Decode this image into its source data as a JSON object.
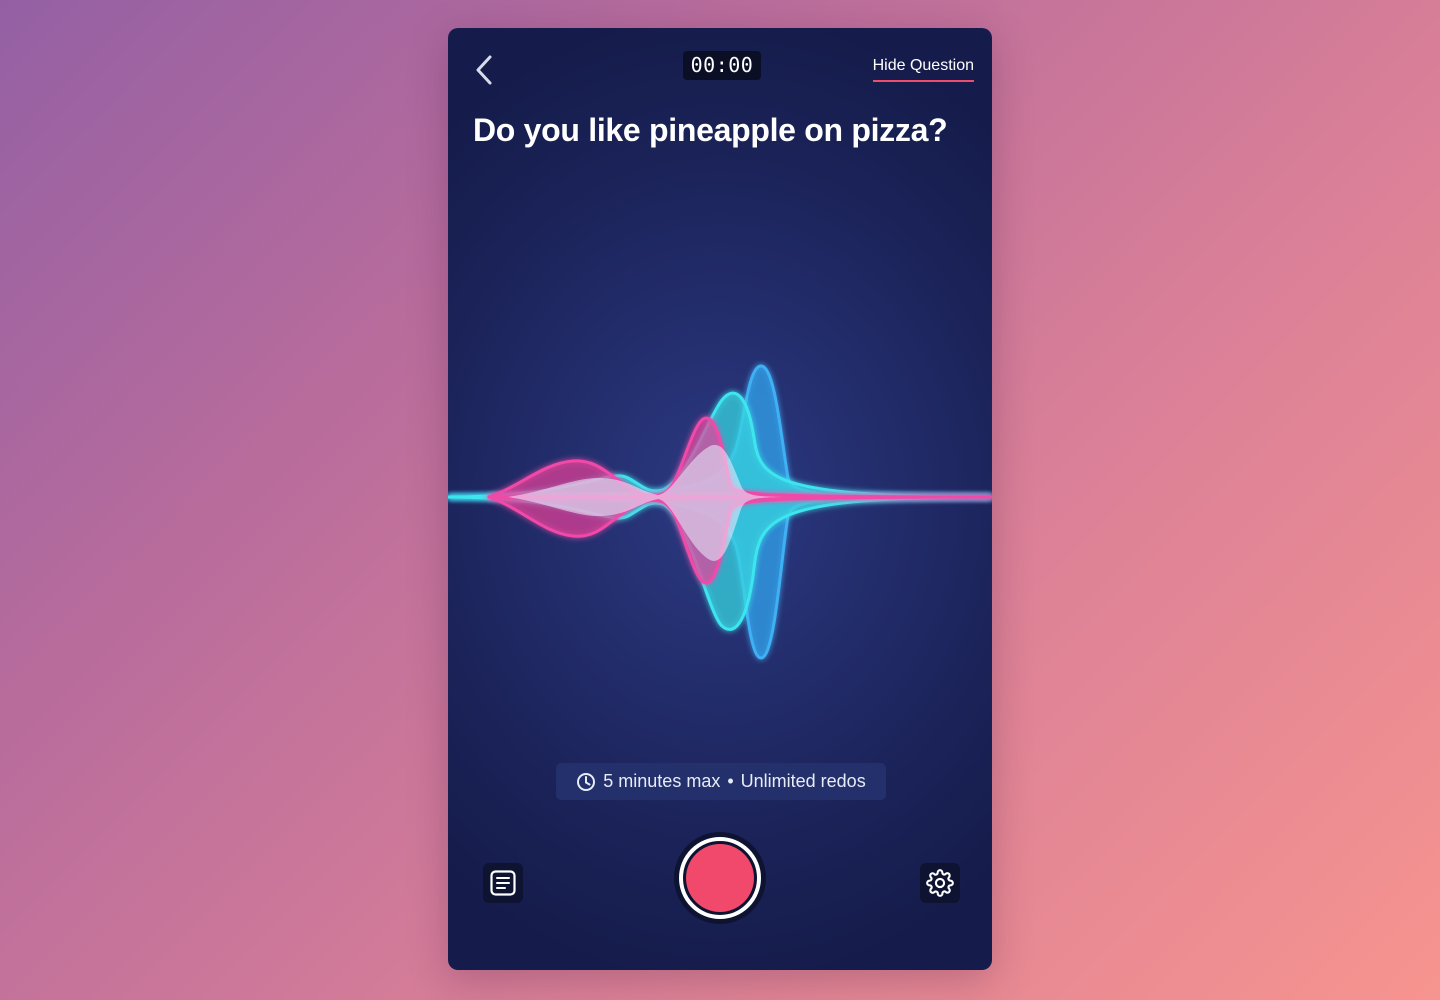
{
  "header": {
    "timer": "00:00",
    "hide_question_label": "Hide Question"
  },
  "question": {
    "text": "Do you like pineapple on pizza?"
  },
  "info": {
    "duration": "5 minutes max",
    "separator": "•",
    "redos": "Unlimited redos"
  },
  "icons": {
    "back": "chevron-left-icon",
    "clock": "clock-icon",
    "notes": "notes-icon",
    "record": "record-icon",
    "settings": "gear-icon"
  },
  "colors": {
    "background_start": "#9460a4",
    "background_end": "#f7948f",
    "panel": "#1c245a",
    "accent_underline": "#ee4d6c",
    "record": "#f0496b",
    "wave_pink": "#e8409a",
    "wave_cyan": "#35d4e0",
    "wave_blue": "#2f9ce6"
  }
}
